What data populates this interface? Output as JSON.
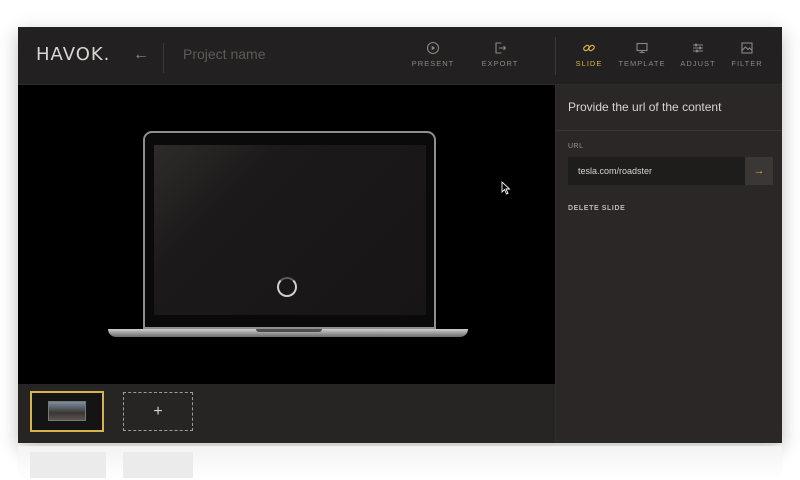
{
  "app": {
    "logo_text": "HAVOK.",
    "project_name_placeholder": "Project name"
  },
  "header": {
    "back_icon": "arrow-left-icon",
    "actions": [
      {
        "label": "PRESENT",
        "icon": "play-circle-icon"
      },
      {
        "label": "EXPORT",
        "icon": "export-icon"
      }
    ],
    "tabs": [
      {
        "label": "SLIDE",
        "icon": "link-icon",
        "active": true
      },
      {
        "label": "TEMPLATE",
        "icon": "monitor-icon",
        "active": false
      },
      {
        "label": "ADJUST",
        "icon": "sliders-icon",
        "active": false
      },
      {
        "label": "FILTER",
        "icon": "image-filter-icon",
        "active": false
      }
    ]
  },
  "panel": {
    "title": "Provide the url of the content",
    "url_label": "URL",
    "url_value": "tesla.com/roadster",
    "go_icon": "arrow-right-icon",
    "delete_label": "DELETE SLIDE"
  },
  "filmstrip": {
    "add_label": "+"
  },
  "colors": {
    "accent": "#d8b24a",
    "background": "#1f1d1c",
    "panel": "#2a2726"
  }
}
